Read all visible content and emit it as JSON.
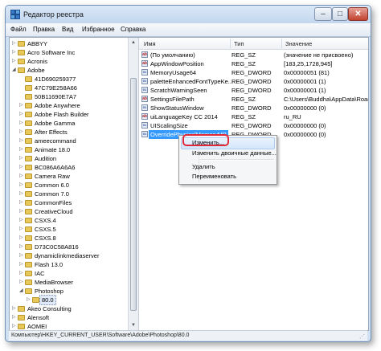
{
  "window": {
    "title": "Редактор реестра",
    "min_glyph": "–",
    "max_glyph": "□",
    "close_glyph": "✕"
  },
  "menu": [
    "Файл",
    "Правка",
    "Вид",
    "Избранное",
    "Справка"
  ],
  "tree": [
    {
      "label": "ABBYY",
      "indent": 1,
      "arrow": "▷"
    },
    {
      "label": "Acro Software Inc",
      "indent": 1,
      "arrow": "▷"
    },
    {
      "label": "Acronis",
      "indent": 1,
      "arrow": "▷"
    },
    {
      "label": "Adobe",
      "indent": 1,
      "arrow": "◢"
    },
    {
      "label": "41D690259377",
      "indent": 2,
      "arrow": ""
    },
    {
      "label": "47C79E258A66",
      "indent": 2,
      "arrow": ""
    },
    {
      "label": "50B11690E7A7",
      "indent": 2,
      "arrow": ""
    },
    {
      "label": "Adobe Anywhere",
      "indent": 2,
      "arrow": "▷"
    },
    {
      "label": "Adobe Flash Builder",
      "indent": 2,
      "arrow": "▷"
    },
    {
      "label": "Adobe Gamma",
      "indent": 2,
      "arrow": "▷"
    },
    {
      "label": "After Effects",
      "indent": 2,
      "arrow": "▷"
    },
    {
      "label": "ameecommand",
      "indent": 2,
      "arrow": "▷"
    },
    {
      "label": "Animate 18.0",
      "indent": 2,
      "arrow": "▷"
    },
    {
      "label": "Audition",
      "indent": 2,
      "arrow": "▷"
    },
    {
      "label": "BC086A6A6A6",
      "indent": 2,
      "arrow": "▷"
    },
    {
      "label": "Camera Raw",
      "indent": 2,
      "arrow": "▷"
    },
    {
      "label": "Common 6.0",
      "indent": 2,
      "arrow": "▷"
    },
    {
      "label": "Common 7.0",
      "indent": 2,
      "arrow": "▷"
    },
    {
      "label": "CommonFiles",
      "indent": 2,
      "arrow": "▷"
    },
    {
      "label": "CreativeCloud",
      "indent": 2,
      "arrow": "▷"
    },
    {
      "label": "CSXS.4",
      "indent": 2,
      "arrow": "▷"
    },
    {
      "label": "CSXS.5",
      "indent": 2,
      "arrow": "▷"
    },
    {
      "label": "CSXS.8",
      "indent": 2,
      "arrow": "▷"
    },
    {
      "label": "D73C0C58A816",
      "indent": 2,
      "arrow": "▷"
    },
    {
      "label": "dynamiclinkmediaserver",
      "indent": 2,
      "arrow": "▷"
    },
    {
      "label": "Flash 13.0",
      "indent": 2,
      "arrow": "▷"
    },
    {
      "label": "IAC",
      "indent": 2,
      "arrow": "▷"
    },
    {
      "label": "MediaBrowser",
      "indent": 2,
      "arrow": "▷"
    },
    {
      "label": "Photoshop",
      "indent": 2,
      "arrow": "◢"
    },
    {
      "label": "80.0",
      "indent": 3,
      "arrow": "▷",
      "selected": true
    },
    {
      "label": "Akeo Consulting",
      "indent": 1,
      "arrow": "▷"
    },
    {
      "label": "Alensoft",
      "indent": 1,
      "arrow": "▷"
    },
    {
      "label": "AOMEI",
      "indent": 1,
      "arrow": "▷"
    }
  ],
  "list_headers": {
    "name": "Имя",
    "type": "Тип",
    "data": "Значение"
  },
  "values": [
    {
      "name": "(По умолчанию)",
      "type": "REG_SZ",
      "data": "(значение не присвоено)",
      "icon": "ab"
    },
    {
      "name": "AppWindowPosition",
      "type": "REG_SZ",
      "data": "[183,25,1728,945]",
      "icon": "ab"
    },
    {
      "name": "MemoryUsage64",
      "type": "REG_DWORD",
      "data": "0x00000051 (81)",
      "icon": "01"
    },
    {
      "name": "paletteEnhancedFontTypeKe...",
      "type": "REG_DWORD",
      "data": "0x00000001 (1)",
      "icon": "01"
    },
    {
      "name": "ScratchWarningSeen",
      "type": "REG_DWORD",
      "data": "0x00000001 (1)",
      "icon": "01"
    },
    {
      "name": "SettingsFilePath",
      "type": "REG_SZ",
      "data": "C:\\Users\\Buddha\\AppData\\Roami",
      "icon": "ab"
    },
    {
      "name": "ShowStatusWindow",
      "type": "REG_DWORD",
      "data": "0x00000000 (0)",
      "icon": "01"
    },
    {
      "name": "uiLanguageKey CC 2014",
      "type": "REG_SZ",
      "data": "ru_RU",
      "icon": "ab"
    },
    {
      "name": "UIScalingSize",
      "type": "REG_DWORD",
      "data": "0x00000000 (0)",
      "icon": "01"
    },
    {
      "name": "OverridePhysicalMemoryMB",
      "type": "REG_DWORD",
      "data": "0x00000000 (0)",
      "icon": "01",
      "selected": true
    }
  ],
  "context_menu": {
    "modify": "Изменить...",
    "modify_binary": "Изменить двоичные данные...",
    "delete": "Удалить",
    "rename": "Переименовать"
  },
  "status_path": "Компьютер\\HKEY_CURRENT_USER\\Software\\Adobe\\Photoshop\\80.0",
  "colors": {
    "selection": "#3399ff",
    "highlight_ring": "#e0283a",
    "folder": "#e9c85a"
  }
}
